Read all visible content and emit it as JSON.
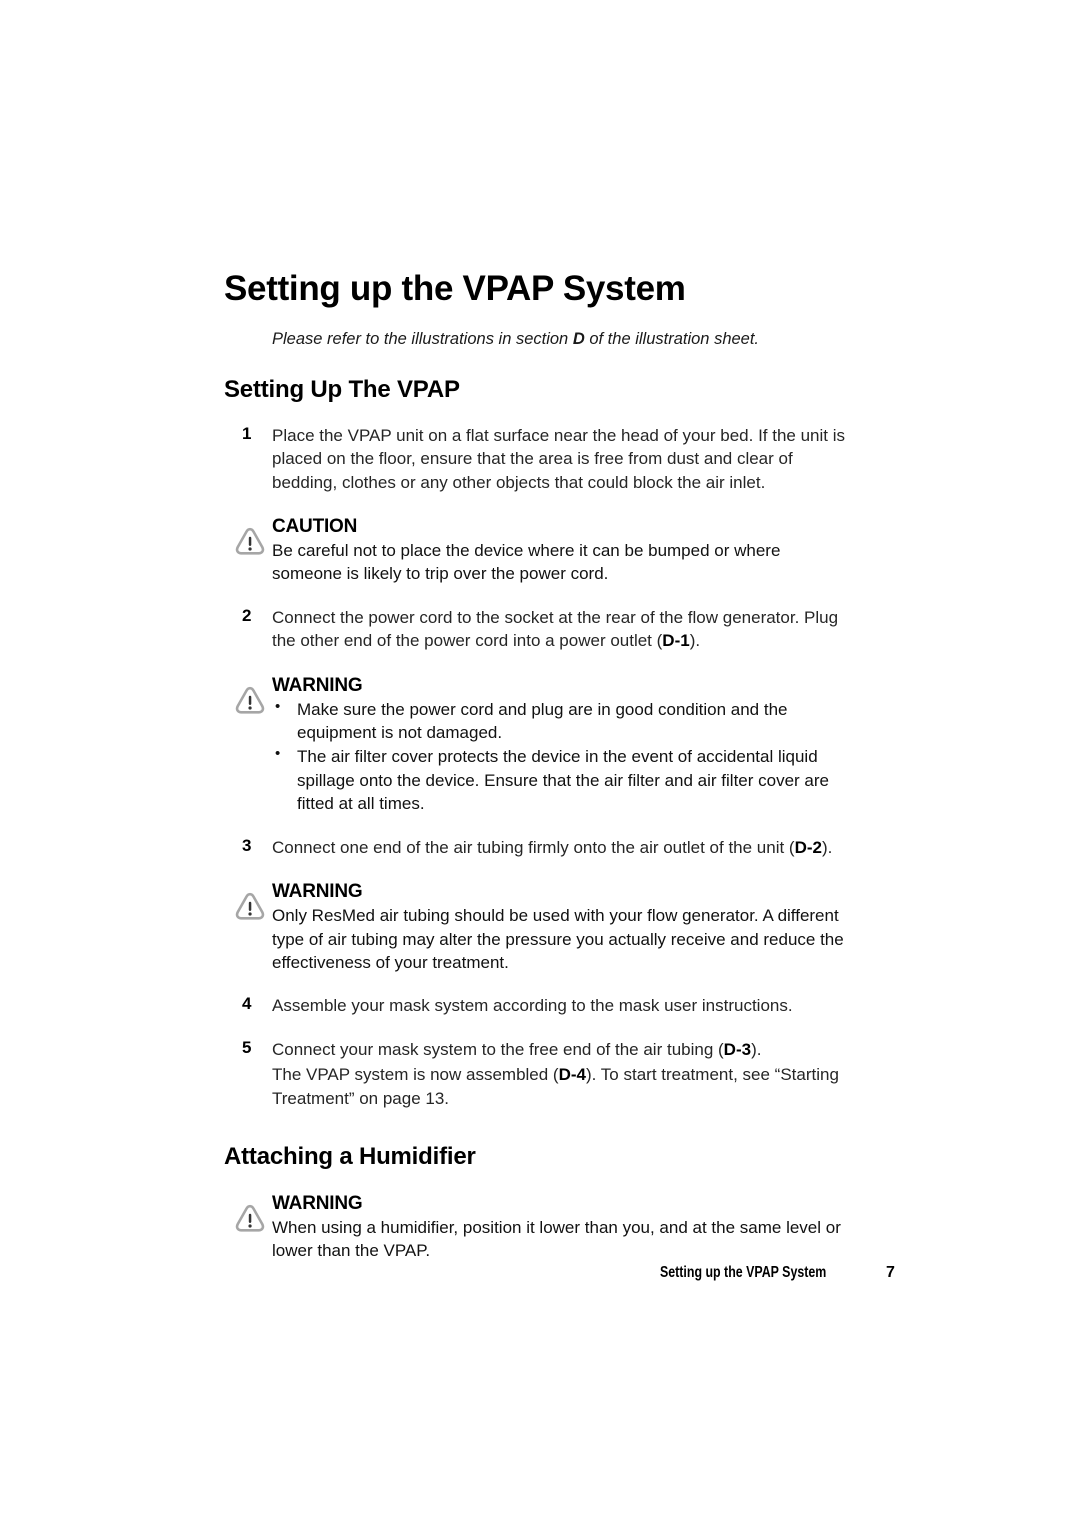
{
  "page": {
    "title": "Setting up the VPAP System",
    "subtitle_pre": "Please refer to the illustrations in section ",
    "subtitle_bold": "D",
    "subtitle_post": " of the illustration sheet."
  },
  "section_setup": {
    "heading": "Setting Up The VPAP",
    "steps": [
      {
        "num": "1",
        "text": "Place the VPAP unit on a flat surface near the head of your bed. If the unit is placed on the floor, ensure that the area is free from dust and clear of bedding, clothes or any other objects that could block the air inlet."
      },
      {
        "num": "2",
        "text_pre": "Connect the power cord to the socket at the rear of the flow generator. Plug the other end of the power cord into a power outlet (",
        "text_bold": "D-1",
        "text_post": ")."
      },
      {
        "num": "3",
        "text_pre": "Connect one end of the air tubing firmly onto the air outlet of the unit (",
        "text_bold": "D-2",
        "text_post": ")."
      },
      {
        "num": "4",
        "text": "Assemble your mask system according to the mask user instructions."
      },
      {
        "num": "5",
        "text_pre": "Connect your mask system to the free end of the air tubing (",
        "text_bold": "D-3",
        "text_post": ").",
        "sub_pre": "The VPAP system is now assembled (",
        "sub_bold": "D-4",
        "sub_post": "). To start treatment, see “Starting Treatment” on page 13."
      }
    ]
  },
  "admonitions": {
    "caution_power": {
      "title": "CAUTION",
      "body": "Be careful not to place the device where it can be bumped or where someone is likely to trip over the power cord."
    },
    "warning_cord": {
      "title": "WARNING",
      "bullet_char": "•",
      "items": [
        "Make sure the power cord and plug are in good condition and the equipment is not damaged.",
        "The air filter cover protects the device in the event of accidental liquid spillage onto the device. Ensure that the air filter and air filter cover are fitted at all times."
      ]
    },
    "warning_tubing": {
      "title": "WARNING",
      "body": "Only ResMed air tubing should be used with your flow generator. A different type of air tubing may alter the pressure you actually receive and reduce the effectiveness of your treatment."
    },
    "warning_humidifier": {
      "title": "WARNING",
      "body": "When using a humidifier, position it lower than you, and at the same level or lower than the VPAP."
    }
  },
  "section_humidifier": {
    "heading": "Attaching a Humidifier"
  },
  "footer": {
    "title": "Setting up the VPAP System",
    "page_number": "7"
  },
  "colors": {
    "icon_outline": "#a6a6a6",
    "icon_mark": "#333333",
    "text": "#1a1a1a",
    "background": "#ffffff"
  }
}
